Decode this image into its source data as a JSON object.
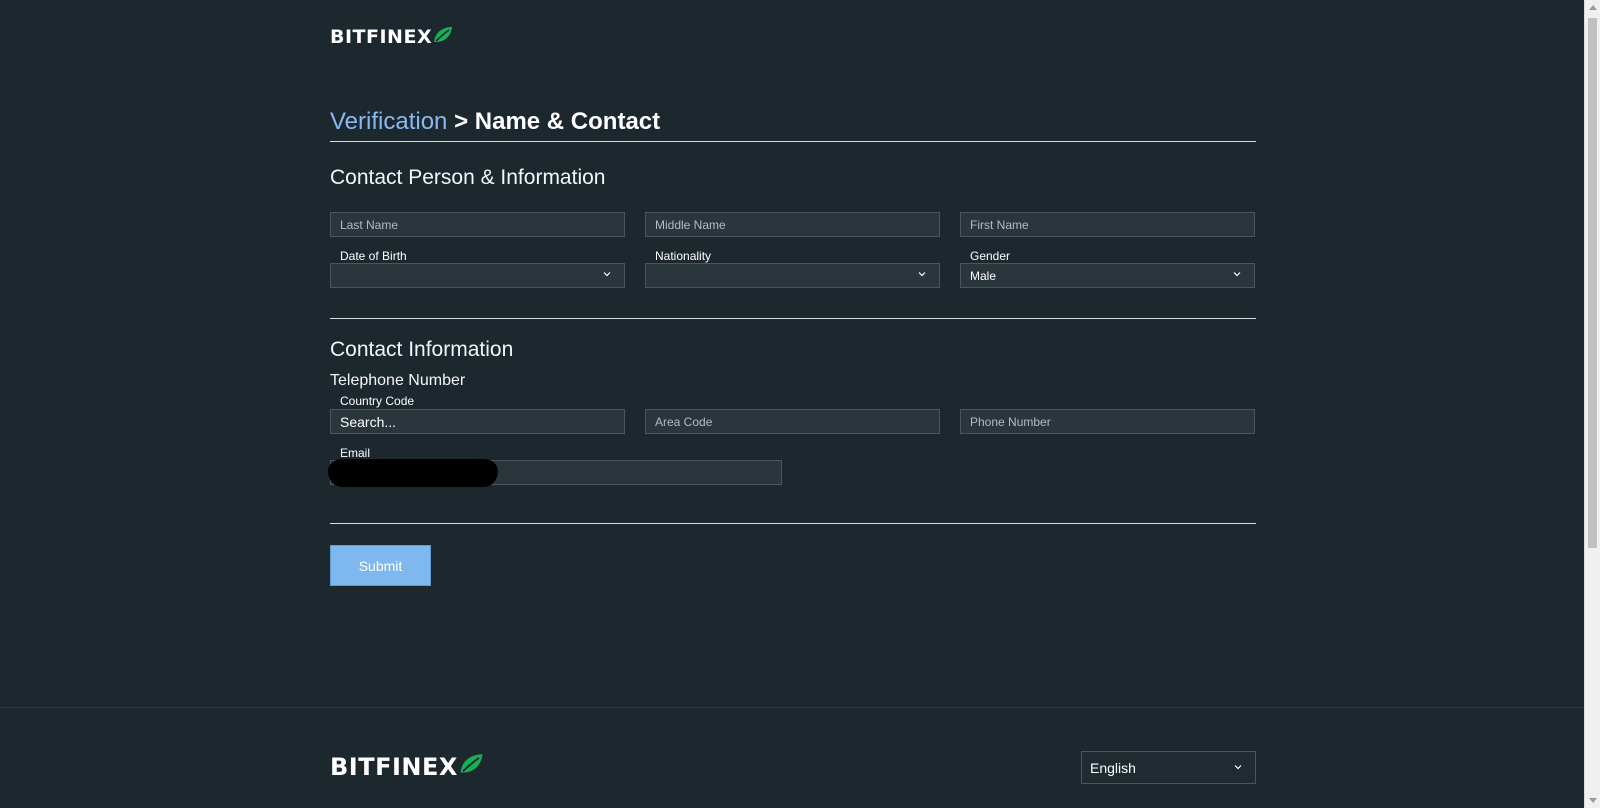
{
  "brand": {
    "name": "BITFINEX",
    "leaf_color": "#16b157"
  },
  "breadcrumb": {
    "parent": "Verification",
    "separator": ">",
    "current": "Name & Contact",
    "parent_color": "#8ab8f0"
  },
  "sections": {
    "person": {
      "title": "Contact Person & Information",
      "last_name_placeholder": "Last Name",
      "middle_name_placeholder": "Middle Name",
      "first_name_placeholder": "First Name",
      "dob_label": "Date of Birth",
      "dob_value": "",
      "nationality_label": "Nationality",
      "nationality_value": "",
      "gender_label": "Gender",
      "gender_value": "Male"
    },
    "contact": {
      "title": "Contact Information",
      "phone_title": "Telephone Number",
      "country_code_label": "Country Code",
      "country_code_placeholder": "Search...",
      "area_code_placeholder": "Area Code",
      "phone_number_placeholder": "Phone Number",
      "email_label": "Email",
      "email_value": ""
    }
  },
  "submit_label": "Submit",
  "footer": {
    "language": "English"
  },
  "icons": {
    "select": "chevron-down-icon",
    "logo": "leaf-icon"
  }
}
